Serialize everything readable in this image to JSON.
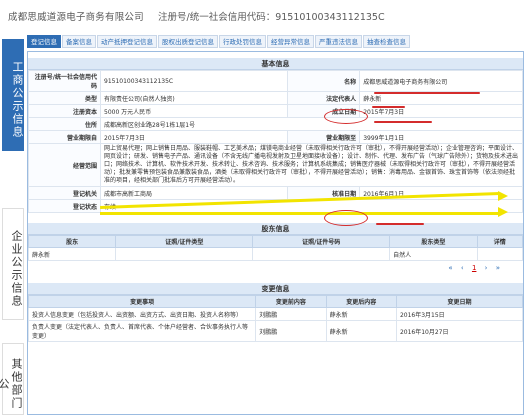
{
  "header": {
    "company": "成都思威道源电子商务有限公司",
    "regno": "注册号/统一社会信用代码：91510100343112135C"
  },
  "sidebar": [
    "工商公示信息",
    "企业公示信息",
    "其他部门公"
  ],
  "tabs": [
    "登记信息",
    "备案信息",
    "动产抵押登记信息",
    "股权出质登记信息",
    "行政处罚信息",
    "经营异常信息",
    "严重违法信息",
    "抽查检查信息"
  ],
  "basic": {
    "title": "基本信息",
    "regno_label": "注册号/统一社会信用代码",
    "regno": "91510100343112135C",
    "name_label": "名称",
    "name": "成都思威道源电子商务有限公司",
    "type_label": "类型",
    "type": "有限责任公司(自然人独资)",
    "legal_label": "法定代表人",
    "legal": "薛永新",
    "capital_label": "注册资本",
    "capital": "5000 万元人民币",
    "founded_label": "成立日期",
    "founded": "2015年7月3日",
    "address_label": "住所",
    "address": "成都高新区创业路28号1栋1层1号",
    "term_from_label": "营业期限自",
    "term_from": "2015年7月3日",
    "term_to_label": "营业期限至",
    "term_to": "3999年1月1日",
    "scope_label": "经营范围",
    "scope": "网上贸易代理；网上销售日用品、服装鞋帽、工艺美术品；煤镁电商业经营（未取得相关行政许可（审批），不得开展经营活动）；企业管理咨询；平面设计、网页设计；研发、销售电子产品、通讯设备（不含无线广播电视发射及卫星地面接收设备）；设计、制作、代理、发布广告（气球广告除外）；货物及技术进出口；网络技术、计算机、软件技术开发、技术转让、技术咨询、技术服务；计算机系统集成；销售医疗器械（未取得相关行政许可（审批），不得开展经营活动）；批发兼零售预包装食品兼散装食品，酒类（未取得相关行政许可（审批），不得开展经营活动）；销售：消毒用品、金银首饰、珠宝首饰等（依法须经批准的项目，经相关部门批准后方可开展经营活动）。",
    "authority_label": "登记机关",
    "authority": "成都市高新工商局",
    "approved_label": "核准日期",
    "approved": "2016年6月1日",
    "status_label": "登记状态",
    "status": "存续"
  },
  "shareholders": {
    "title": "股东信息",
    "headers": [
      "股东",
      "证照/证件类型",
      "证照/证件号码",
      "股东类型",
      "详情"
    ],
    "rows": [
      [
        "薛永新",
        "",
        "",
        "自然人",
        ""
      ]
    ],
    "pager": [
      "«",
      "‹",
      "1",
      "›",
      "»"
    ]
  },
  "changes": {
    "title": "变更信息",
    "headers": [
      "变更事项",
      "变更前内容",
      "变更后内容",
      "变更日期"
    ],
    "rows": [
      [
        "投资人信息变更（包括投资人、出资额、出资方式、出资日期、投资人名称等）",
        "刘鹏鹏",
        "薛永新",
        "2016年3月15日"
      ],
      [
        "负责人变更（法定代表人、负责人、首席代表、个体户经营者、合伙事务执行人等变更）",
        "刘鹏鹏",
        "薛永新",
        "2016年10月27日"
      ]
    ]
  }
}
